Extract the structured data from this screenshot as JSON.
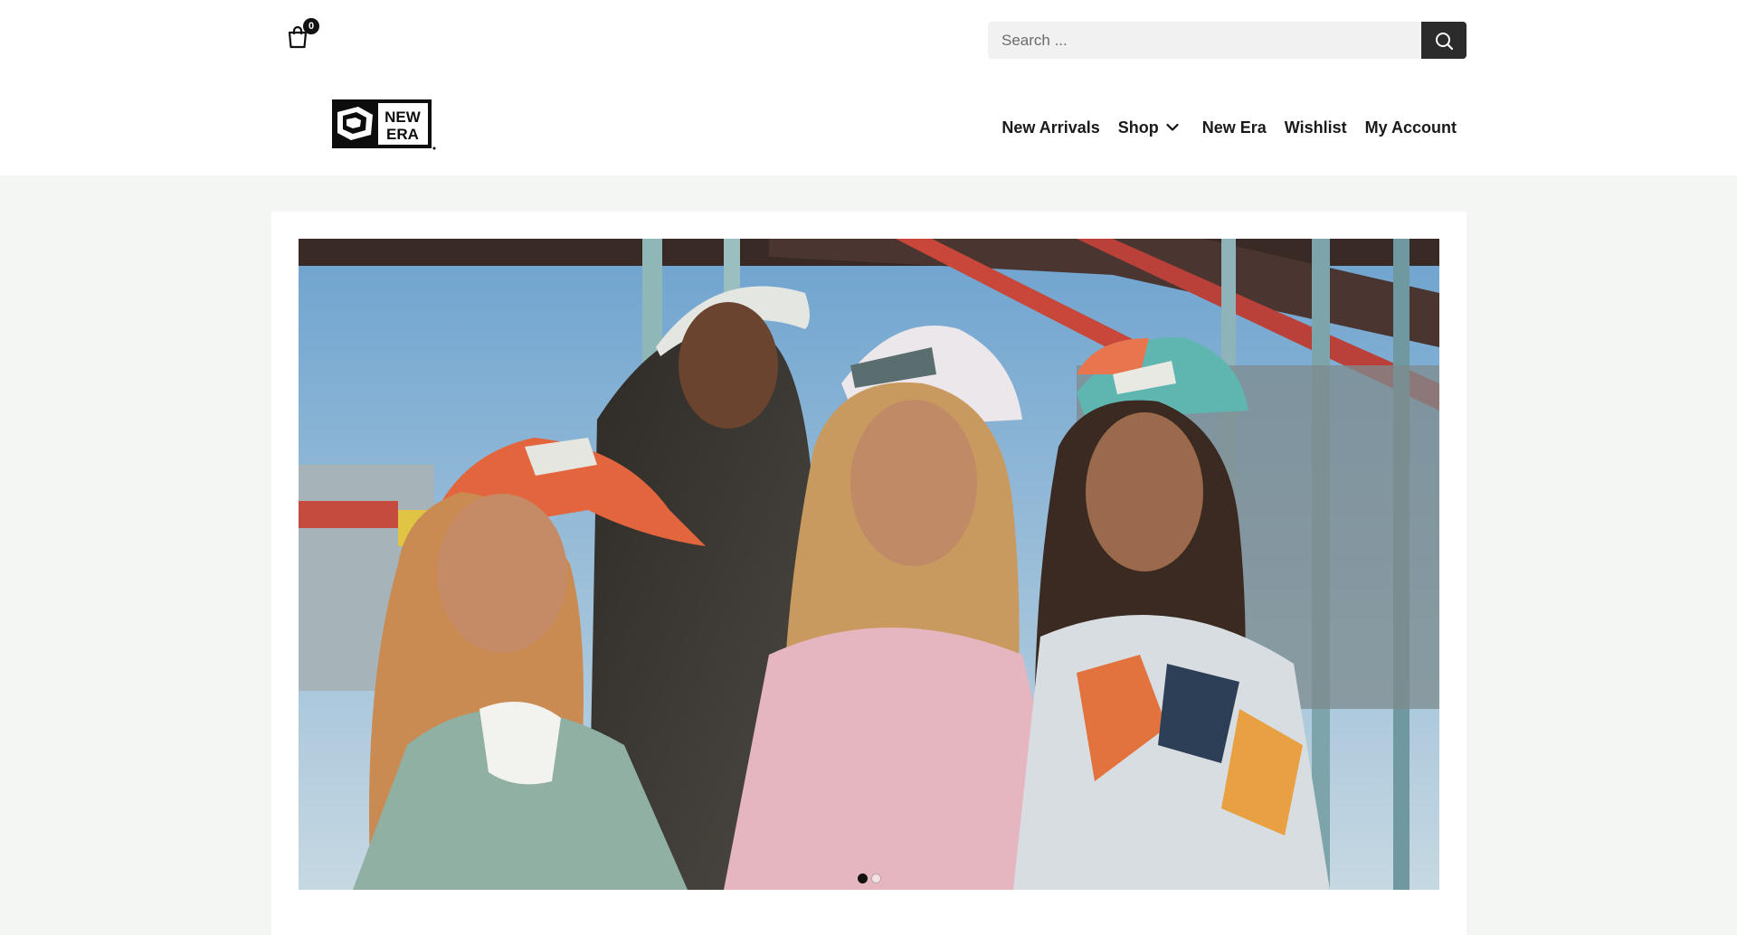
{
  "cart": {
    "count": "0",
    "icon": "shopping-bag-icon"
  },
  "search": {
    "placeholder": "Search ...",
    "value": "",
    "icon": "search-icon"
  },
  "logo": {
    "line1": "NEW",
    "line2": "ERA"
  },
  "nav": {
    "items": [
      {
        "label": "New Arrivals"
      },
      {
        "label": "Shop",
        "icon": "chevron-down-icon"
      },
      {
        "label": "New Era"
      },
      {
        "label": "Wishlist"
      },
      {
        "label": "My Account"
      }
    ]
  },
  "hero": {
    "image_subject": "four women wearing colorful baseball caps at a stadium",
    "slides": 2,
    "active_slide": 1
  },
  "colors": {
    "page_bg": "#f4f6f3",
    "header_bg": "#ffffff",
    "search_button": "#2b2b2b",
    "accent": "#111111"
  }
}
